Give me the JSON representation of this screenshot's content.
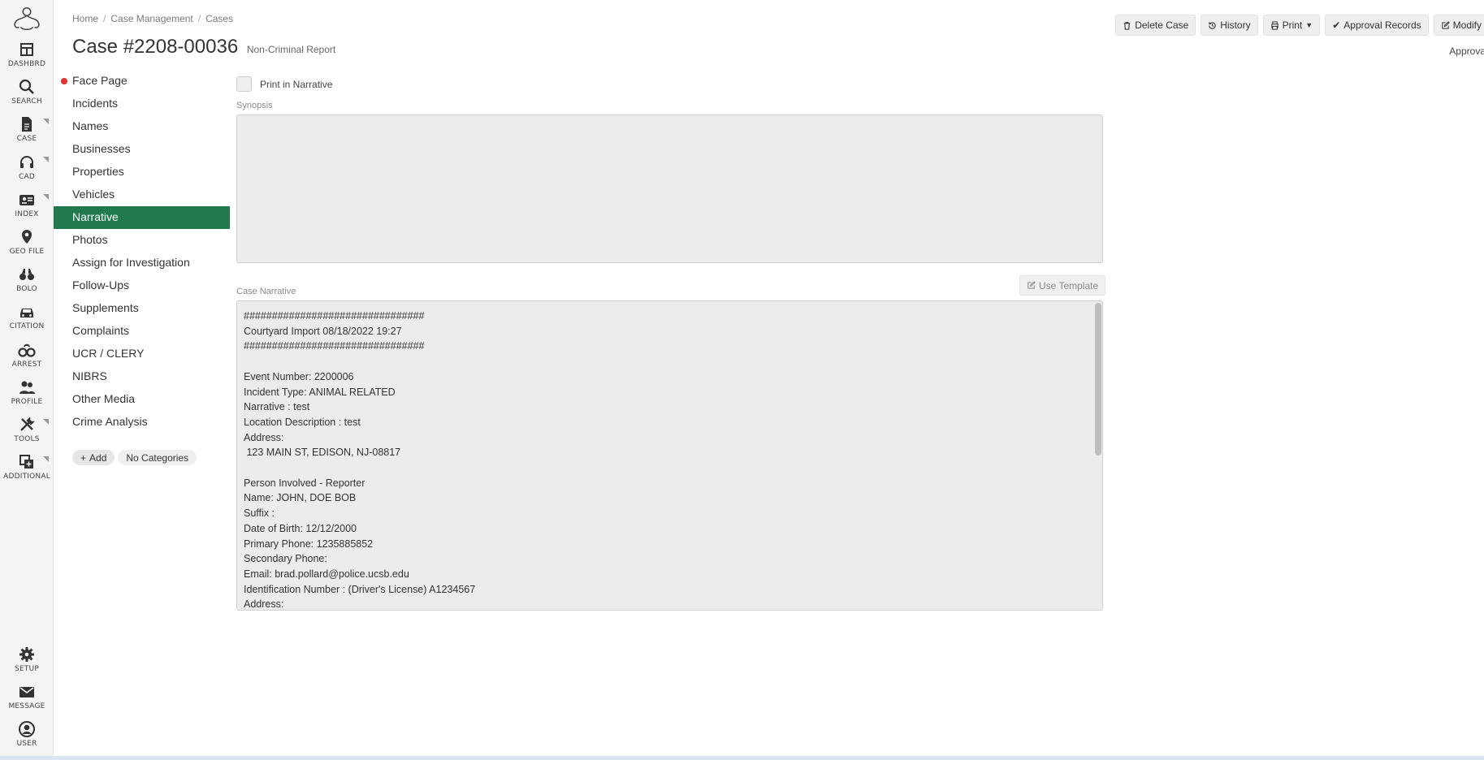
{
  "rail": {
    "items": [
      {
        "label": "DASHBRD",
        "icon": "dashboard-icon",
        "sub": false
      },
      {
        "label": "SEARCH",
        "icon": "search-icon",
        "sub": false
      },
      {
        "label": "CASE",
        "icon": "document-icon",
        "sub": true
      },
      {
        "label": "CAD",
        "icon": "headset-icon",
        "sub": true
      },
      {
        "label": "INDEX",
        "icon": "index-card-icon",
        "sub": true
      },
      {
        "label": "GEO FILE",
        "icon": "map-pin-icon",
        "sub": false
      },
      {
        "label": "BOLO",
        "icon": "binoculars-icon",
        "sub": false
      },
      {
        "label": "CITATION",
        "icon": "car-icon",
        "sub": false
      },
      {
        "label": "ARREST",
        "icon": "handcuffs-icon",
        "sub": false
      },
      {
        "label": "PROFILE",
        "icon": "people-icon",
        "sub": false
      },
      {
        "label": "TOOLS",
        "icon": "tools-icon",
        "sub": true
      },
      {
        "label": "ADDITIONAL",
        "icon": "plus-square-icon",
        "sub": true
      }
    ],
    "bottom": [
      {
        "label": "SETUP",
        "icon": "gear-icon"
      },
      {
        "label": "MESSAGE",
        "icon": "envelope-icon"
      },
      {
        "label": "USER",
        "icon": "user-circle-icon"
      }
    ]
  },
  "breadcrumb": [
    "Home",
    "Case Management",
    "Cases"
  ],
  "header": {
    "title": "Case #2208-00036",
    "subtitle": "Non-Criminal Report",
    "approval_note": "Approva"
  },
  "actions": {
    "delete": "Delete Case",
    "history": "History",
    "print": "Print",
    "approval_records": "Approval Records",
    "modify": "Modify"
  },
  "nav": {
    "items": [
      "Face Page",
      "Incidents",
      "Names",
      "Businesses",
      "Properties",
      "Vehicles",
      "Narrative",
      "Photos",
      "Assign for Investigation",
      "Follow-Ups",
      "Supplements",
      "Complaints",
      "UCR / CLERY",
      "NIBRS",
      "Other Media",
      "Crime Analysis"
    ],
    "active": "Narrative",
    "flagged": "Face Page",
    "add_label": "Add",
    "categories_label": "No Categories"
  },
  "form": {
    "print_in_narrative": "Print in Narrative",
    "synopsis_label": "Synopsis",
    "synopsis_value": "",
    "narrative_label": "Case Narrative",
    "use_template": "Use Template",
    "narrative_text": "################################\nCourtyard Import 08/18/2022 19:27\n################################\n\nEvent Number: 2200006\nIncident Type: ANIMAL RELATED\nNarrative : test\nLocation Description : test\nAddress:\n 123 MAIN ST, EDISON, NJ-08817\n\nPerson Involved - Reporter\nName: JOHN, DOE BOB\nSuffix :\nDate of Birth: 12/12/2000\nPrimary Phone: 1235885852\nSecondary Phone:\nEmail: brad.pollard@police.ucsb.edu\nIdentification Number : (Driver's License) A1234567\nAddress:"
  },
  "colors": {
    "active_nav": "#217a4e",
    "flag_dot": "#e53030"
  }
}
